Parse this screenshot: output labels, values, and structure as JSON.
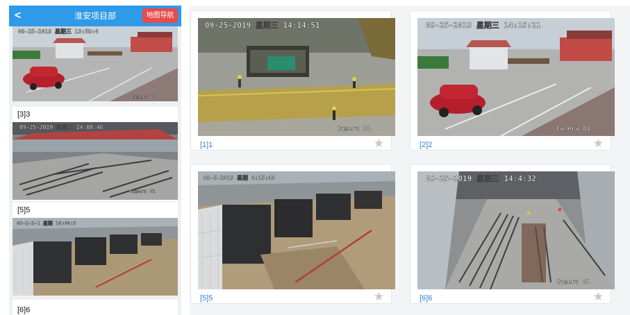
{
  "header": {
    "back_icon": "chevron-left-icon",
    "back_glyph": "<",
    "title": "淮安项目部",
    "map_nav_label": "地图导航",
    "colors": {
      "bar": "#2e9ae8",
      "map_button": "#e84b4b"
    }
  },
  "sidebar": {
    "items": [
      {
        "label": "",
        "osd_time": "09-25-2019 星期三 13:59:4",
        "osd_camera": "Camera 01"
      },
      {
        "label": "[3]3",
        "osd_time": "09-25-2019 星期三 14:00:48",
        "osd_camera": "Camera 01"
      },
      {
        "label": "[5]5",
        "osd_time": "09-2-2-1 星期 14:00:3",
        "osd_camera": ""
      },
      {
        "label": "[6]6"
      }
    ]
  },
  "cameras": [
    {
      "label": "[1]1",
      "osd_time": "09-25-2019 星期三 14:14:51",
      "osd_camera": "Camera 01",
      "star_icon": "star-icon",
      "star_glyph": "★"
    },
    {
      "label": "[2]2",
      "osd_time": "09-25-2019 星期三 14:15:21",
      "osd_camera": "Camera 01",
      "star_icon": "star-icon",
      "star_glyph": "★"
    },
    {
      "label": "[5]5",
      "osd_time": "09-5-2019 星期 4:15:43",
      "osd_camera": "",
      "star_icon": "star-icon",
      "star_glyph": "★"
    },
    {
      "label": "[6]6",
      "osd_time": "09-25-2019 星期三 14:4:32",
      "osd_camera": "Camera 01",
      "star_icon": "star-icon",
      "star_glyph": "★"
    }
  ],
  "colors": {
    "link": "#2f7fd1",
    "star": "#c7c7c7"
  }
}
